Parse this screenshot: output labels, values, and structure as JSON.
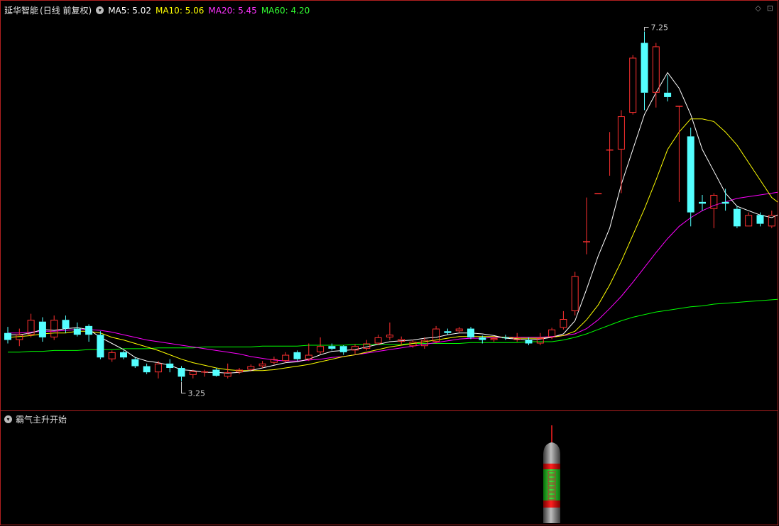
{
  "header": {
    "title": "延华智能",
    "period": "(日线 前复权)",
    "ma5": "MA5: 5.02",
    "ma10": "MA10: 5.06",
    "ma20": "MA20: 5.45",
    "ma60": "MA60: 4.20"
  },
  "colors": {
    "ma5": "#ffffff",
    "ma10": "#ffff00",
    "ma20": "#ff00ff",
    "ma60": "#00ff00",
    "up": "#ff3030",
    "down": "#54ffff",
    "border": "#b02020"
  },
  "indicator_panel": {
    "title": "霸气主升开始"
  },
  "chart_data": {
    "type": "candlestick",
    "high_label": "7.25",
    "low_label": "3.25",
    "price_range": [
      3.1,
      7.4
    ],
    "candles": [
      [
        3.8,
        3.72,
        3.87,
        3.68
      ],
      [
        3.72,
        3.78,
        3.85,
        3.65
      ],
      [
        3.78,
        3.95,
        4.02,
        3.75
      ],
      [
        3.93,
        3.75,
        3.98,
        3.7
      ],
      [
        3.75,
        3.95,
        4.0,
        3.72
      ],
      [
        3.95,
        3.85,
        4.0,
        3.8
      ],
      [
        3.85,
        3.78,
        3.92,
        3.76
      ],
      [
        3.88,
        3.78,
        3.9,
        3.7
      ],
      [
        3.78,
        3.52,
        3.82,
        3.5
      ],
      [
        3.5,
        3.58,
        3.6,
        3.47
      ],
      [
        3.58,
        3.52,
        3.6,
        3.5
      ],
      [
        3.5,
        3.42,
        3.52,
        3.4
      ],
      [
        3.42,
        3.35,
        3.45,
        3.33
      ],
      [
        3.35,
        3.45,
        3.48,
        3.28
      ],
      [
        3.45,
        3.4,
        3.5,
        3.35
      ],
      [
        3.4,
        3.3,
        3.42,
        3.25
      ],
      [
        3.32,
        3.36,
        3.38,
        3.28
      ],
      [
        3.35,
        3.36,
        3.38,
        3.3
      ],
      [
        3.38,
        3.31,
        3.4,
        3.3
      ],
      [
        3.3,
        3.35,
        3.45,
        3.28
      ],
      [
        3.35,
        3.38,
        3.4,
        3.33
      ],
      [
        3.38,
        3.42,
        3.44,
        3.36
      ],
      [
        3.42,
        3.45,
        3.48,
        3.4
      ],
      [
        3.46,
        3.5,
        3.53,
        3.44
      ],
      [
        3.48,
        3.55,
        3.58,
        3.46
      ],
      [
        3.58,
        3.5,
        3.6,
        3.48
      ],
      [
        3.5,
        3.55,
        3.68,
        3.48
      ],
      [
        3.58,
        3.65,
        3.75,
        3.56
      ],
      [
        3.65,
        3.62,
        3.68,
        3.6
      ],
      [
        3.65,
        3.58,
        3.66,
        3.55
      ],
      [
        3.6,
        3.65,
        3.67,
        3.56
      ],
      [
        3.62,
        3.68,
        3.72,
        3.6
      ],
      [
        3.68,
        3.75,
        3.78,
        3.66
      ],
      [
        3.75,
        3.78,
        3.92,
        3.72
      ],
      [
        3.7,
        3.73,
        3.76,
        3.66
      ],
      [
        3.65,
        3.7,
        3.72,
        3.63
      ],
      [
        3.65,
        3.72,
        3.75,
        3.62
      ],
      [
        3.7,
        3.85,
        3.88,
        3.68
      ],
      [
        3.82,
        3.8,
        3.85,
        3.78
      ],
      [
        3.82,
        3.85,
        3.87,
        3.8
      ],
      [
        3.85,
        3.75,
        3.87,
        3.73
      ],
      [
        3.75,
        3.72,
        3.77,
        3.68
      ],
      [
        3.72,
        3.74,
        3.76,
        3.7
      ],
      [
        3.75,
        3.74,
        3.78,
        3.72
      ],
      [
        3.72,
        3.75,
        3.8,
        3.7
      ],
      [
        3.72,
        3.68,
        3.75,
        3.66
      ],
      [
        3.68,
        3.74,
        3.8,
        3.66
      ],
      [
        3.75,
        3.84,
        3.86,
        3.73
      ],
      [
        3.86,
        3.96,
        4.05,
        3.84
      ],
      [
        4.05,
        4.45,
        4.5,
        4.0
      ],
      [
        4.85,
        4.85,
        5.35,
        4.7
      ],
      [
        5.4,
        5.4,
        5.4,
        5.4
      ],
      [
        5.9,
        5.9,
        6.1,
        5.6
      ],
      [
        5.9,
        6.28,
        6.35,
        5.4
      ],
      [
        6.32,
        6.95,
        6.98,
        6.3
      ],
      [
        7.12,
        6.55,
        7.25,
        6.35
      ],
      [
        6.55,
        7.08,
        7.12,
        6.38
      ],
      [
        6.55,
        6.5,
        6.75,
        6.45
      ],
      [
        6.4,
        6.4,
        6.4,
        5.3
      ],
      [
        6.05,
        5.18,
        6.15,
        5.02
      ],
      [
        5.3,
        5.28,
        5.38,
        5.2
      ],
      [
        5.22,
        5.38,
        5.4,
        5.0
      ],
      [
        5.3,
        5.28,
        5.45,
        5.2
      ],
      [
        5.22,
        5.02,
        5.25,
        5.0
      ],
      [
        5.02,
        5.15,
        5.18,
        5.02
      ],
      [
        5.15,
        5.05,
        5.18,
        5.02
      ],
      [
        5.02,
        5.15,
        5.2,
        5.0
      ],
      [
        5.15,
        5.48,
        5.58,
        5.12
      ],
      [
        5.38,
        5.25,
        5.48,
        5.22
      ]
    ],
    "ma5": [
      3.78,
      3.78,
      3.8,
      3.84,
      3.83,
      3.85,
      3.86,
      3.84,
      3.75,
      3.68,
      3.61,
      3.52,
      3.48,
      3.46,
      3.43,
      3.38,
      3.37,
      3.35,
      3.35,
      3.34,
      3.35,
      3.37,
      3.4,
      3.43,
      3.46,
      3.47,
      3.5,
      3.55,
      3.59,
      3.6,
      3.61,
      3.64,
      3.67,
      3.7,
      3.71,
      3.72,
      3.74,
      3.75,
      3.78,
      3.8,
      3.8,
      3.79,
      3.77,
      3.74,
      3.73,
      3.72,
      3.73,
      3.75,
      3.79,
      3.94,
      4.3,
      4.68,
      5.0,
      5.5,
      5.9,
      6.3,
      6.55,
      6.78,
      6.6,
      6.3,
      5.9,
      5.65,
      5.4,
      5.25,
      5.2,
      5.15,
      5.12,
      5.18,
      5.22
    ],
    "ma10": [
      3.75,
      3.76,
      3.77,
      3.79,
      3.8,
      3.8,
      3.82,
      3.82,
      3.8,
      3.75,
      3.72,
      3.68,
      3.64,
      3.6,
      3.55,
      3.5,
      3.46,
      3.43,
      3.4,
      3.38,
      3.37,
      3.37,
      3.37,
      3.38,
      3.4,
      3.42,
      3.44,
      3.47,
      3.5,
      3.53,
      3.55,
      3.58,
      3.61,
      3.64,
      3.66,
      3.68,
      3.7,
      3.72,
      3.74,
      3.76,
      3.76,
      3.76,
      3.76,
      3.75,
      3.74,
      3.74,
      3.74,
      3.75,
      3.77,
      3.82,
      3.95,
      4.12,
      4.35,
      4.62,
      4.92,
      5.22,
      5.55,
      5.9,
      6.1,
      6.25,
      6.25,
      6.22,
      6.1,
      5.95,
      5.75,
      5.55,
      5.35,
      5.25,
      5.2
    ],
    "ma20": [
      3.8,
      3.8,
      3.81,
      3.82,
      3.82,
      3.83,
      3.84,
      3.84,
      3.83,
      3.81,
      3.78,
      3.75,
      3.72,
      3.7,
      3.68,
      3.66,
      3.64,
      3.62,
      3.6,
      3.58,
      3.56,
      3.53,
      3.51,
      3.49,
      3.48,
      3.48,
      3.49,
      3.5,
      3.52,
      3.53,
      3.55,
      3.57,
      3.59,
      3.61,
      3.63,
      3.65,
      3.67,
      3.69,
      3.71,
      3.73,
      3.74,
      3.74,
      3.75,
      3.75,
      3.75,
      3.75,
      3.75,
      3.76,
      3.77,
      3.79,
      3.85,
      3.95,
      4.08,
      4.22,
      4.38,
      4.55,
      4.72,
      4.88,
      5.02,
      5.12,
      5.2,
      5.26,
      5.3,
      5.34,
      5.36,
      5.38,
      5.4,
      5.42,
      5.45
    ],
    "ma60": [
      3.58,
      3.58,
      3.59,
      3.59,
      3.6,
      3.6,
      3.6,
      3.61,
      3.61,
      3.61,
      3.62,
      3.62,
      3.62,
      3.63,
      3.63,
      3.63,
      3.63,
      3.64,
      3.64,
      3.64,
      3.64,
      3.64,
      3.65,
      3.65,
      3.65,
      3.65,
      3.66,
      3.66,
      3.66,
      3.66,
      3.67,
      3.67,
      3.67,
      3.67,
      3.67,
      3.68,
      3.68,
      3.68,
      3.68,
      3.68,
      3.69,
      3.69,
      3.69,
      3.69,
      3.69,
      3.7,
      3.7,
      3.7,
      3.72,
      3.75,
      3.79,
      3.84,
      3.89,
      3.94,
      3.98,
      4.01,
      4.04,
      4.06,
      4.08,
      4.1,
      4.11,
      4.13,
      4.14,
      4.15,
      4.16,
      4.17,
      4.18,
      4.19,
      4.2
    ]
  },
  "signal": {
    "bar_index": 47,
    "label": "霸气主升"
  }
}
